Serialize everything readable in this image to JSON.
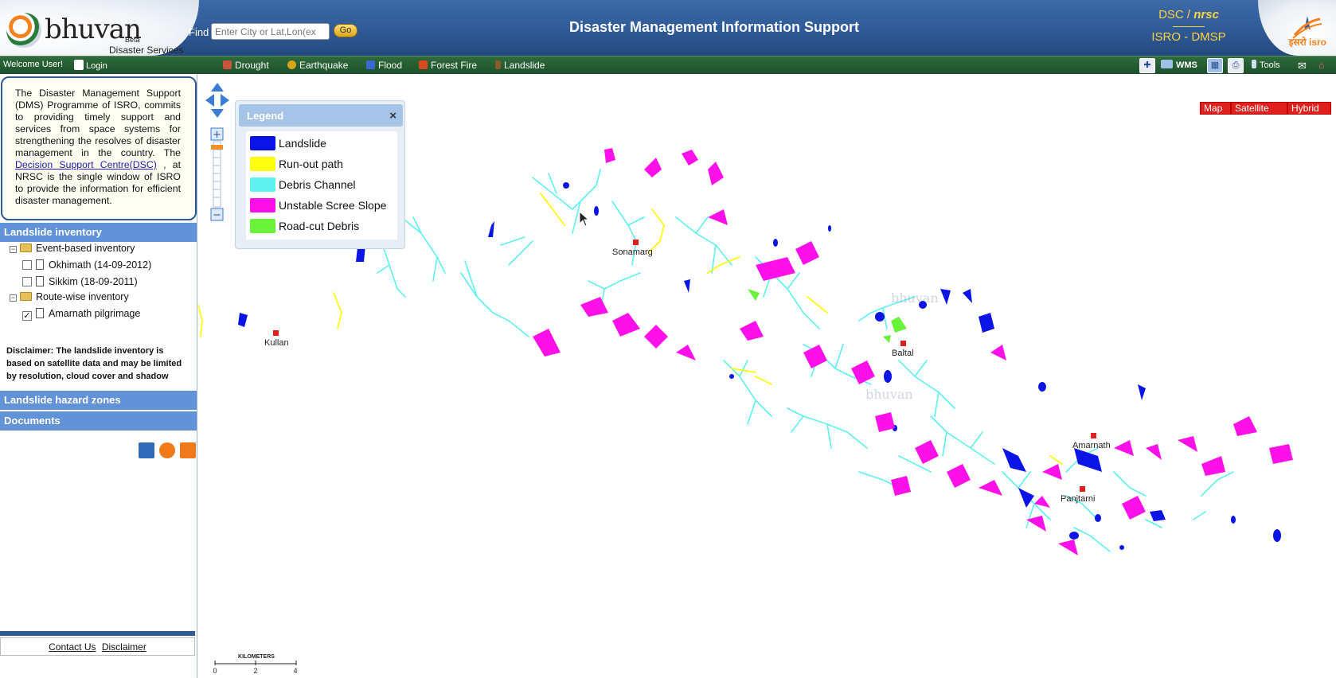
{
  "header": {
    "logo_text": "bhuvan",
    "logo_beta": "Beta",
    "logo_subtitle": "Disaster Services",
    "find_label": "Find",
    "find_placeholder": "Enter City or Lat,Lon(ex",
    "go_label": "Go",
    "title": "Disaster Management Information Support",
    "dsc_top_a": "DSC / ",
    "dsc_top_b": "nrsc",
    "dsc_bottom": "ISRO - DMSP",
    "isro_text": "इसरो isro"
  },
  "toolbar": {
    "welcome": "Welcome User!",
    "login": "Login",
    "menu": [
      {
        "label": "Drought",
        "color": "#c8553a"
      },
      {
        "label": "Earthquake",
        "color": "#d9a516"
      },
      {
        "label": "Flood",
        "color": "#3a6ad1"
      },
      {
        "label": "Forest Fire",
        "color": "#d64a1e"
      },
      {
        "label": "Landslide",
        "color": "#8a5a2a"
      }
    ],
    "wms_label": "WMS",
    "tools_label": "Tools"
  },
  "sidebar": {
    "intro_pre": "The Disaster Management Support (DMS) Programme of ISRO, commits to providing timely support and services from space systems for strengthening the resolves of disaster management in the country. The ",
    "intro_link": "Decision Support Centre(DSC)",
    "intro_post": " , at NRSC is the single window of ISRO to provide the information for efficient disaster management.",
    "section_inventory": "Landslide inventory",
    "tree": {
      "event_based": "Event-based inventory",
      "okhimath": "Okhimath (14-09-2012)",
      "sikkim": "Sikkim (18-09-2011)",
      "route_wise": "Route-wise inventory",
      "amarnath": "Amarnath pilgrimage"
    },
    "disclaimer": "Disclaimer: The landslide inventory is based on satellite data and may be limited by resolution, cloud cover and shadow",
    "section_hazard": "Landslide hazard zones",
    "section_documents": "Documents",
    "footer_contact": "Contact Us",
    "footer_disclaimer": "Disclaimer"
  },
  "legend": {
    "title": "Legend",
    "close": "×",
    "items": [
      {
        "label": "Landslide",
        "color": "#0a14e6"
      },
      {
        "label": "Run-out path",
        "color": "#ffff10"
      },
      {
        "label": "Debris Channel",
        "color": "#5ff0f0"
      },
      {
        "label": "Unstable Scree Slope",
        "color": "#ff10e8"
      },
      {
        "label": "Road-cut Debris",
        "color": "#6af23a"
      }
    ]
  },
  "map_types": [
    "Map",
    "Satellite",
    "Hybrid"
  ],
  "places": {
    "sonamarg": "Sonamarg",
    "kullan": "Kullan",
    "baltal": "Baltal",
    "amarnath": "Amarnath",
    "panjtarni": "Panjtarni"
  },
  "watermark": "bhuvan",
  "scale": {
    "unit": "KILOMETERS",
    "ticks": [
      "0",
      "2",
      "4"
    ]
  }
}
